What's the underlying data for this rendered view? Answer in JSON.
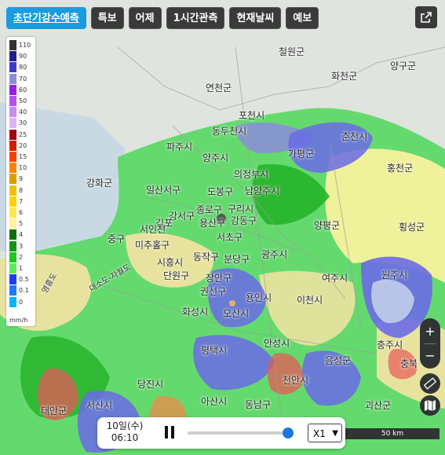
{
  "tabs": [
    {
      "label": "초단기강수예측",
      "active": true
    },
    {
      "label": "특보",
      "active": false
    },
    {
      "label": "어제",
      "active": false
    },
    {
      "label": "1시간관측",
      "active": false
    },
    {
      "label": "현재날씨",
      "active": false
    },
    {
      "label": "예보",
      "active": false
    }
  ],
  "legend": {
    "unit": "mm/h",
    "items": [
      {
        "label": "110",
        "color": "#333333"
      },
      {
        "label": "90",
        "color": "#1f1f8c"
      },
      {
        "label": "80",
        "color": "#3c3cc8"
      },
      {
        "label": "70",
        "color": "#8c8cdc"
      },
      {
        "label": "60",
        "color": "#9a1ee0"
      },
      {
        "label": "50",
        "color": "#b450e8"
      },
      {
        "label": "40",
        "color": "#c88cf0"
      },
      {
        "label": "30",
        "color": "#ddb4f5"
      },
      {
        "label": "25",
        "color": "#a00014"
      },
      {
        "label": "20",
        "color": "#d21e00"
      },
      {
        "label": "15",
        "color": "#f04600"
      },
      {
        "label": "10",
        "color": "#ff8200"
      },
      {
        "label": "9",
        "color": "#d8a000"
      },
      {
        "label": "8",
        "color": "#f0c000"
      },
      {
        "label": "7",
        "color": "#ffd200"
      },
      {
        "label": "6",
        "color": "#ffe650"
      },
      {
        "label": "5",
        "color": "#fff59a"
      },
      {
        "label": "4",
        "color": "#0a6e0a"
      },
      {
        "label": "3",
        "color": "#149614"
      },
      {
        "label": "2",
        "color": "#1ec81e"
      },
      {
        "label": "1",
        "color": "#5aeb5a"
      },
      {
        "label": "0.5",
        "color": "#1e3cff"
      },
      {
        "label": "0.1",
        "color": "#1e78ff"
      },
      {
        "label": "0",
        "color": "#00b4ff"
      }
    ]
  },
  "places": [
    "철원군",
    "양구군",
    "화천군",
    "연천군",
    "포천시",
    "동두천시",
    "춘천시",
    "파주시",
    "양주시",
    "가평군",
    "의정부시",
    "홍천군",
    "강화군",
    "일산서구",
    "도봉구",
    "남양주시",
    "강서구",
    "종로구",
    "구리시",
    "용산구",
    "강동구",
    "서초구",
    "양평군",
    "횡성군",
    "김포",
    "서인천",
    "중구",
    "미추홀구",
    "동작구",
    "분당구",
    "광주시",
    "여주시",
    "원주시",
    "시흥시",
    "단원구",
    "장안구",
    "권선구",
    "용인시",
    "이천시",
    "화성시",
    "오산시",
    "평택시",
    "안성시",
    "충주시",
    "음성군",
    "충북",
    "당진시",
    "천안시",
    "서산시",
    "태안군",
    "아산시",
    "동남구",
    "괴산군",
    "대소도-자월도",
    "영흥도"
  ],
  "icons": {
    "external": "external-link-icon",
    "zoom_in": "plus-icon",
    "zoom_out": "minus-icon",
    "ruler": "ruler-icon",
    "map_layers": "map-icon",
    "pause": "pause-icon"
  },
  "controls": {
    "zoom_in": "+",
    "zoom_out": "−"
  },
  "scale": {
    "label": "50 km"
  },
  "player": {
    "date": "10일(수)",
    "time": "06:10",
    "progress": 1.0,
    "speed": "X1"
  }
}
